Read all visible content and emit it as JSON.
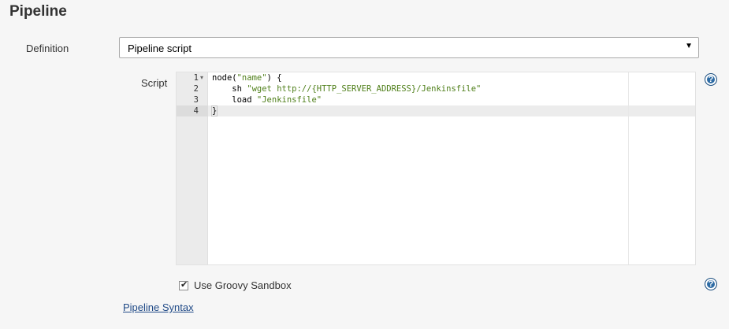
{
  "section": {
    "title": "Pipeline"
  },
  "definition": {
    "label": "Definition",
    "selected": "Pipeline script",
    "arrow": "▼"
  },
  "script": {
    "label": "Script",
    "lines": [
      {
        "number": "1",
        "fold": "▾",
        "pre": "node(",
        "str": "\"name\"",
        "post": ") {"
      },
      {
        "number": "2",
        "fold": "",
        "pre": "    sh ",
        "str": "\"wget http://{HTTP_SERVER_ADDRESS}/Jenkinsfile\"",
        "post": ""
      },
      {
        "number": "3",
        "fold": "",
        "pre": "    load ",
        "str": "\"Jenkinsfile\"",
        "post": ""
      },
      {
        "number": "4",
        "fold": "",
        "pre": "}",
        "str": "",
        "post": ""
      }
    ],
    "active_line": "4"
  },
  "help": {
    "symbol": "?"
  },
  "sandbox": {
    "label": "Use Groovy Sandbox",
    "checked": true,
    "check_mark": "✔"
  },
  "syntax_link": {
    "label": "Pipeline Syntax"
  },
  "colors": {
    "string": "#4f7f1a",
    "link": "#204a87",
    "help": "#2d6ba4"
  }
}
